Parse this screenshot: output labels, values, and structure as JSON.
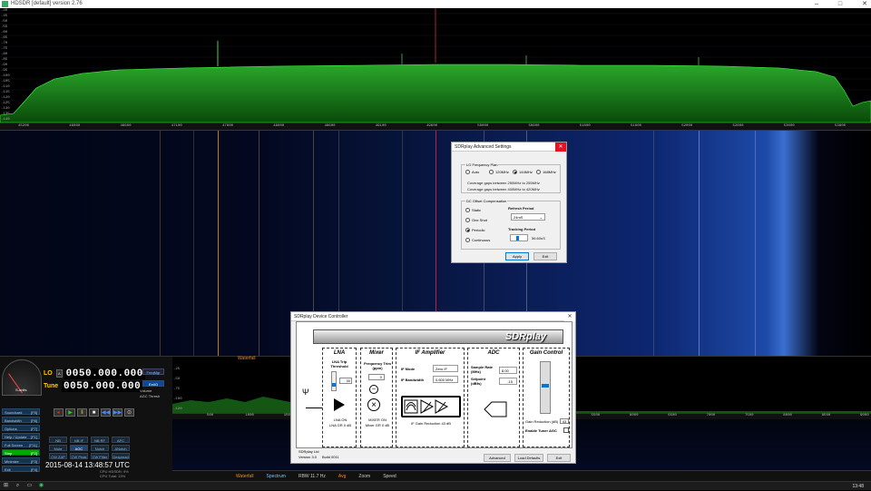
{
  "window": {
    "title": "HDSDR [default] version 2.76",
    "controls": [
      "–",
      "□",
      "✕"
    ]
  },
  "spectrum": {
    "db_labels": [
      "-40",
      "-45",
      "-50",
      "-55",
      "-60",
      "-65",
      "-70",
      "-75",
      "-80",
      "-85",
      "-90",
      "-95",
      "-100",
      "-105",
      "-110",
      "-115",
      "-120",
      "-125",
      "-130",
      "-135",
      "-140"
    ],
    "freq_labels": [
      "45200",
      "46000",
      "46600",
      "47100",
      "47600",
      "48000",
      "48600",
      "49100",
      "49600",
      "50000",
      "50600",
      "51000",
      "51600",
      "52000",
      "52600",
      "53000",
      "53600"
    ]
  },
  "radio": {
    "lo_label": "LO",
    "lo_mini": "A",
    "lo_freq": "0050.000.000",
    "tune_label": "Tune",
    "tune_mini": "B",
    "tune_freq": "0050.000.000",
    "freqmgr": "FreqMgr",
    "extio": "ExtIO",
    "volume": "Volume",
    "agc_thresh": "AGC Thresh",
    "s_units": "S-units",
    "date_time": "2015-08-14  13:48:57 UTC",
    "cpu_lines": [
      "CPU HDSDR: 9%",
      "CPU Total: 13%"
    ]
  },
  "left_buttons": [
    {
      "label": "Soundcard",
      "key": "[F5]"
    },
    {
      "label": "Bandwidth",
      "key": "[F6]"
    },
    {
      "label": "Options",
      "key": "[F7]"
    },
    {
      "label": "Help / Update",
      "key": "[F1]"
    },
    {
      "label": "Full Screen",
      "key": "[F11]"
    },
    {
      "label": "Stop",
      "key": "[F2]"
    },
    {
      "label": "Minimize",
      "key": "[F3]"
    },
    {
      "label": "Exit",
      "key": "[F4]"
    }
  ],
  "mode_buttons": [
    [
      "NB",
      "NB IF",
      "NB RF",
      "AFC"
    ],
    [
      "Mute",
      "AGC Fixed",
      "Notch",
      "ANotch"
    ],
    [
      "CW ZAP",
      "CW Peak",
      "CW Filter",
      "Despread"
    ]
  ],
  "mini_spectrum": {
    "label": "Waterfall",
    "db_labels": [
      "-25",
      "-50",
      "-75",
      "-100",
      "-120"
    ],
    "freq_labels": [
      "500",
      "1000",
      "1500",
      "2000",
      "2500",
      "3000",
      "3500",
      "4000",
      "4500",
      "5000",
      "5500",
      "6000",
      "6500",
      "7000",
      "7500",
      "8000",
      "8500",
      "9000"
    ]
  },
  "bottom_bar": {
    "waterfall": "Waterfall",
    "spectrum": "Spectrum",
    "rbw": "RBW 11.7 Hz",
    "avg": "Avg",
    "zoom": "Zoom",
    "speed": "Speed"
  },
  "clock": "13:48",
  "advanced_dialog": {
    "title": "SDRplay Advanced Settings",
    "lo_group": "LO Frequency Plan",
    "lo_options": [
      {
        "label": "Auto",
        "selected": false
      },
      {
        "label": "120MHz",
        "selected": false
      },
      {
        "label": "144MHz",
        "selected": true
      },
      {
        "label": "168MHz",
        "selected": false
      }
    ],
    "coverage1": "Coverage gaps between 250MHz to 255MHz",
    "coverage2": "Coverage gaps between 400MHz to 420MHz",
    "dc_group": "DC Offset Compensation",
    "dc_options": [
      {
        "label": "Static",
        "selected": false
      },
      {
        "label": "One Shot",
        "selected": false
      },
      {
        "label": "Periodic",
        "selected": true
      },
      {
        "label": "Continuous",
        "selected": false
      }
    ],
    "refresh_label": "Refresh Period",
    "refresh_value": "24mS",
    "tracking_label": "Tracking Period",
    "tracking_value": "56.60uS",
    "apply": "Apply",
    "exit": "Exit"
  },
  "controller_dialog": {
    "title": "SDRplay Device Controller",
    "banner": "SDRplay",
    "lna": {
      "title": "LNA",
      "threshold": "LNA Trip Threshold",
      "value": "30",
      "status": "LNA ON",
      "gr": "LNA GR 0 dB"
    },
    "mixer": {
      "title": "Mixer",
      "trim": "Frequency Trim (ppm)",
      "trim_value": "0",
      "status": "MIXER ON",
      "gr": "Mixer GR 0 dB"
    },
    "if": {
      "title": "IF Amplifier",
      "mode_label": "IF Mode",
      "mode": "Zero IF",
      "bw_label": "IF Bandwidth",
      "bw": "0.600 MHz",
      "gr": "IF Gain Reduction 43 dB"
    },
    "adc": {
      "title": "ADC",
      "rate_label": "Sample Rate (MHz)",
      "rate": "8.00",
      "setpoint_label": "Setpoint (dBfs)",
      "setpoint": "-15"
    },
    "gain": {
      "title": "Gain Control",
      "gr_label": "Gain Reduction (dB)",
      "gr_value": "43",
      "tuner_agc": "Enable Tuner AGC"
    },
    "footer": [
      "SDRplay Ltd",
      "Version 3.0",
      "Build 0011"
    ],
    "advanced": "Advanced",
    "load_defaults": "Load Defaults",
    "exit": "Exit"
  },
  "colors": {
    "accent": "#0a4a9a",
    "spectrum_fill": "#1f8a1f",
    "waterfall_blue": "#1d4aa8",
    "marker": "#f80"
  }
}
